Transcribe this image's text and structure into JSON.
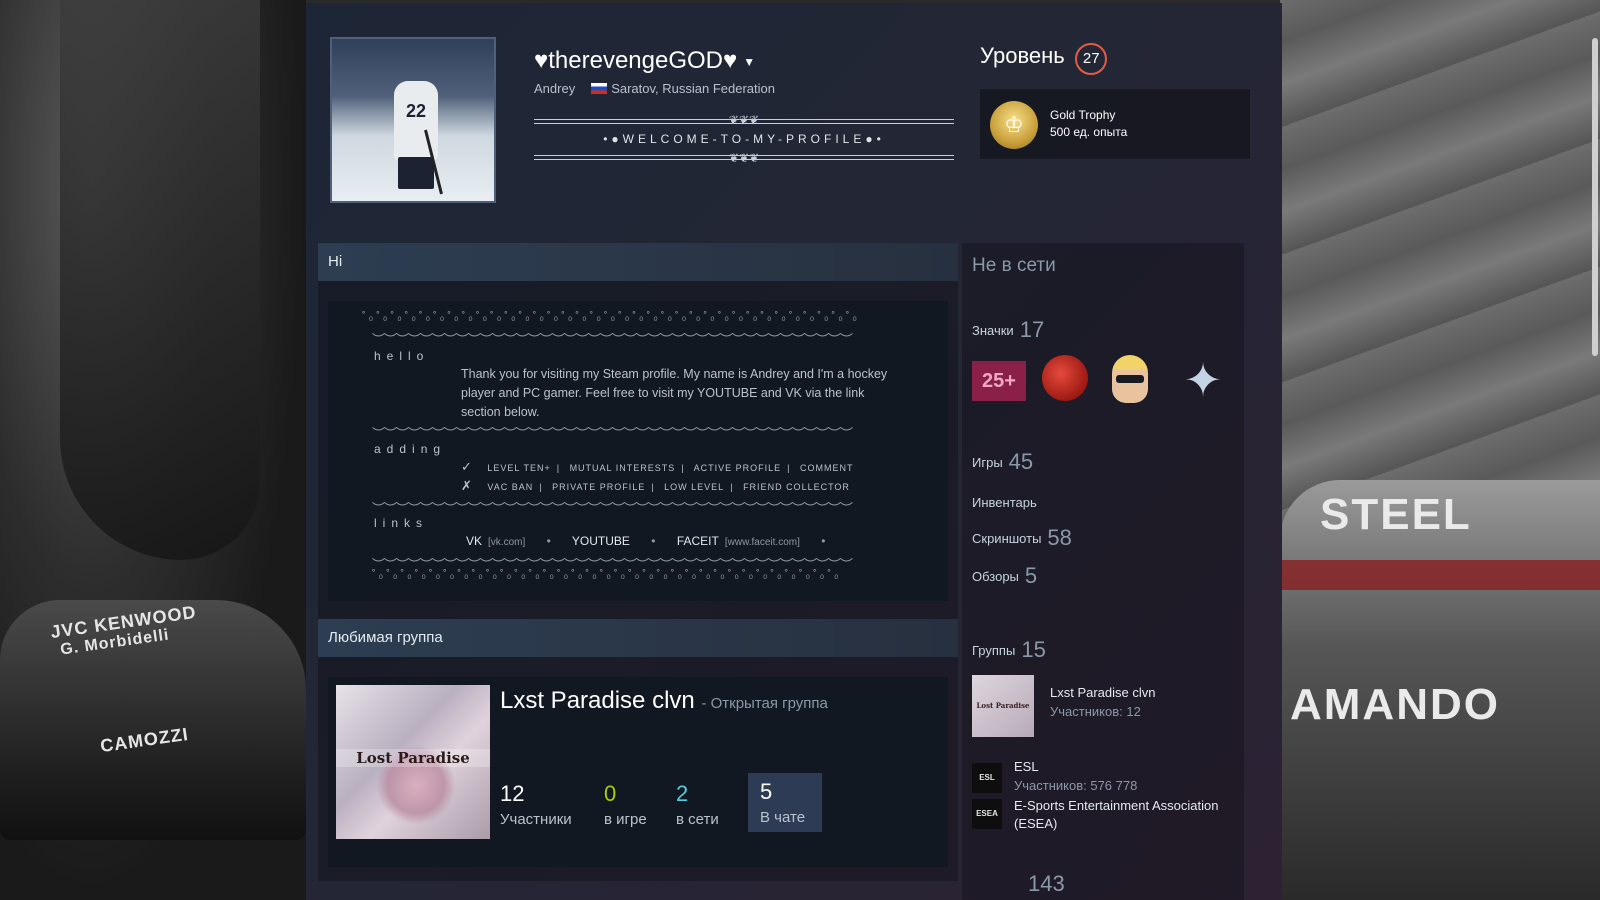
{
  "profile": {
    "persona_name": "♥therevengeGOD♥",
    "real_name": "Andrey",
    "location": "Saratov, Russian Federation",
    "welcome_text": "•●WELCOME-TO-MY-PROFILE●•",
    "avatar_number": "22"
  },
  "level": {
    "label": "Уровень",
    "value": "27"
  },
  "trophy": {
    "name": "Gold Trophy",
    "xp": "500 ед. опыта"
  },
  "summary": {
    "header": "Hi",
    "hello_label": "hello",
    "intro": "Thank you for visiting my Steam profile. My name is Andrey and I'm a hockey player and PC gamer. Feel free to visit my YOUTUBE and VK via the link section below.",
    "adding_label": "adding",
    "accept_mark": "✓",
    "accept_rules": [
      "LEVEL TEN+",
      "MUTUAL INTERESTS",
      "ACTIVE PROFILE",
      "COMMENT"
    ],
    "reject_mark": "✗",
    "reject_rules": [
      "VAC BAN",
      "PRIVATE PROFILE",
      "LOW LEVEL",
      "FRIEND COLLECTOR"
    ],
    "links_label": "links",
    "links": [
      {
        "name": "VK",
        "domain": "[vk.com]"
      },
      {
        "name": "YOUTUBE",
        "domain": ""
      },
      {
        "name": "FACEIT",
        "domain": "[www.faceit.com]"
      }
    ],
    "bullet": "•"
  },
  "favorite_group": {
    "header": "Любимая группа",
    "name": "Lxst Paradise clvn",
    "type": "- Открытая группа",
    "logo_text": "Lost Paradise",
    "members_count": "12",
    "members_label": "Участники",
    "ingame_count": "0",
    "ingame_label": "в игре",
    "online_count": "2",
    "online_label": "в сети",
    "chat_count": "5",
    "chat_label": "В чате"
  },
  "sidebar": {
    "status": "Не в сети",
    "badges_label": "Значки",
    "badges_count": "17",
    "badge_25_text": "25+",
    "games_label": "Игры",
    "games_count": "45",
    "inventory_label": "Инвентарь",
    "screenshots_label": "Скриншоты",
    "screenshots_count": "58",
    "reviews_label": "Обзоры",
    "reviews_count": "5",
    "groups_label": "Группы",
    "groups_count": "15",
    "groups": [
      {
        "name": "Lxst Paradise clvn",
        "members": "Участников: 12",
        "thumb": "Lost Paradise"
      },
      {
        "name": "ESL",
        "members": "Участников: 576 778",
        "thumb": "ESL"
      },
      {
        "name": "E-Sports Entertainment Association (ESEA)",
        "members": "",
        "thumb": "ESEA"
      }
    ],
    "friends_count": "143"
  },
  "background": {
    "left_car_text_1": "JVC KENWOOD",
    "left_car_text_2": "G. Morbidelli",
    "left_car_text_3": "CAMOZZI",
    "right_car_text_1": "STEEL",
    "right_car_text_2": "AMANDO"
  }
}
